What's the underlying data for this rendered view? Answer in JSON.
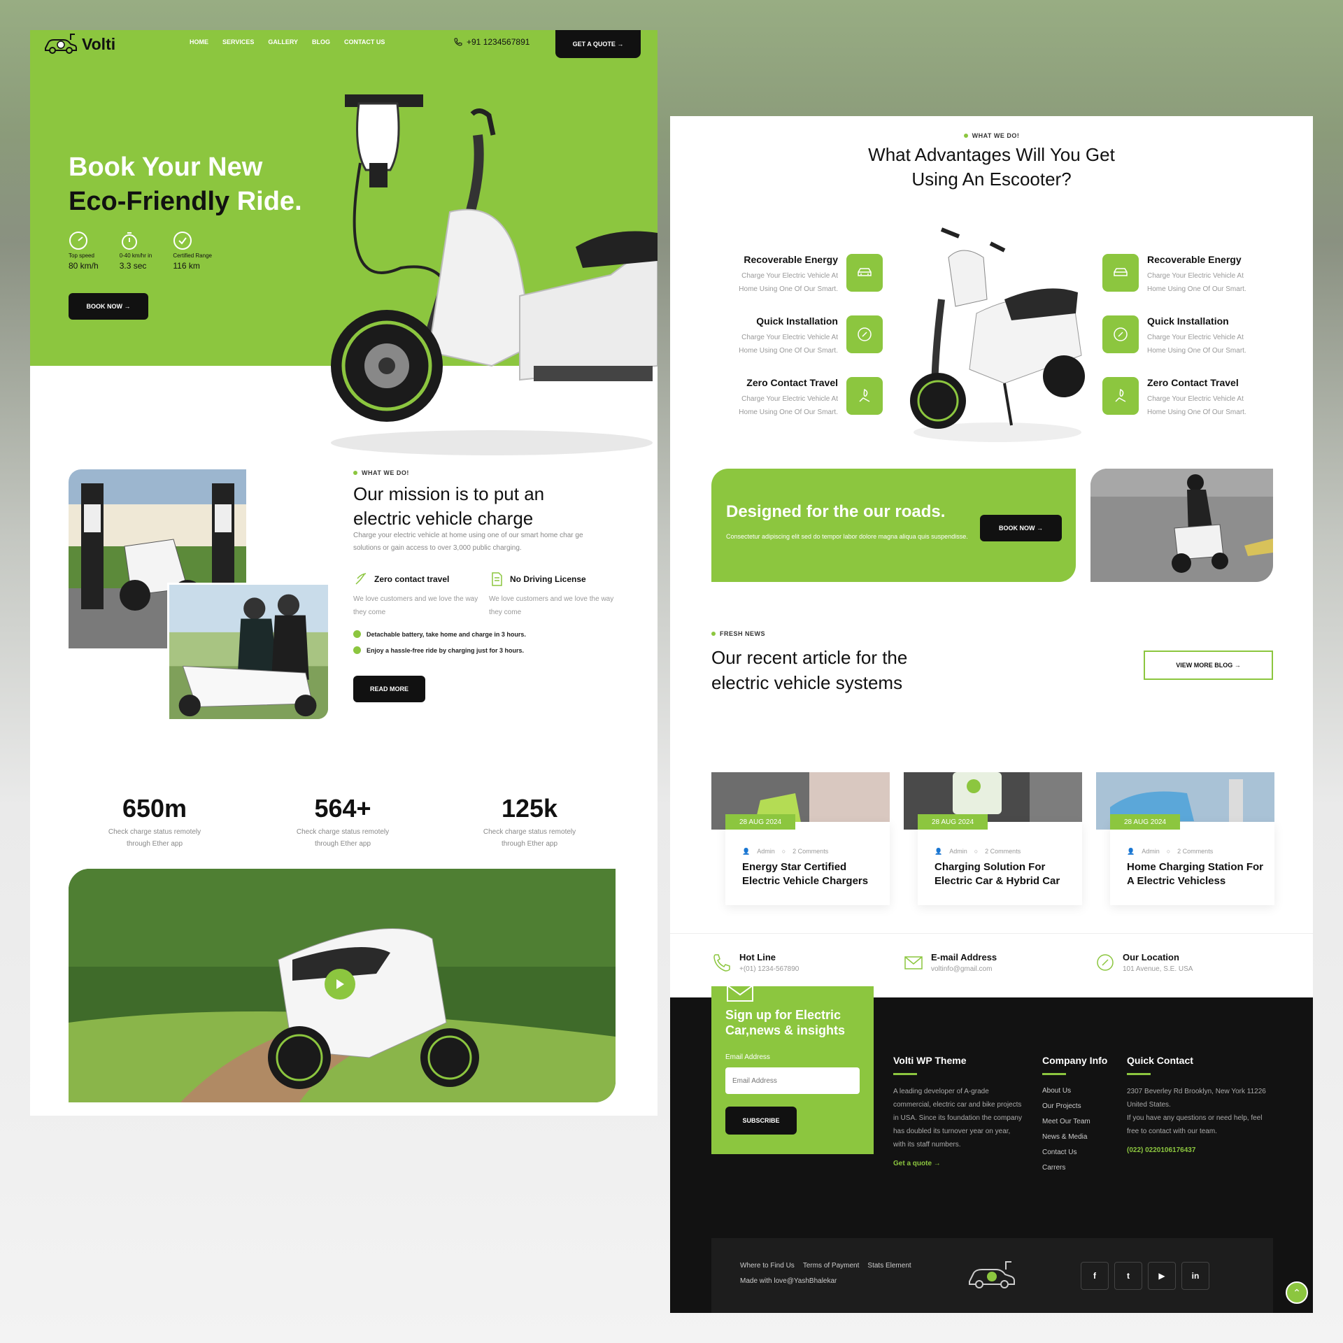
{
  "nav": {
    "brand": "Volti",
    "items": [
      "HOME",
      "SERVICES",
      "GALLERY",
      "BLOG",
      "CONTACT US"
    ],
    "phone": "+91 1234567891",
    "quote": "GET A QUOTE →"
  },
  "hero": {
    "title_a": "Book Your New",
    "title_b": "Eco-Friendly ",
    "title_c": "Ride.",
    "stats": [
      {
        "label": "Top speed",
        "value": "80 km/h"
      },
      {
        "label": "0-40 km/hr in",
        "value": "3.3 sec"
      },
      {
        "label": "Certified Range",
        "value": "116 km"
      }
    ],
    "cta": "BOOK NOW →"
  },
  "mission": {
    "eyebrow": "WHAT WE DO!",
    "title": "Our mission is to put an electric vehicle charge",
    "desc": "Charge your electric vehicle at home using one of our smart home char ge solutions or gain access to over 3,000 public charging.",
    "f1": {
      "title": "Zero contact travel",
      "text": "We love customers and we love the way they come"
    },
    "f2": {
      "title": "No Driving License",
      "text": "We love customers and we love the way they come"
    },
    "checks": [
      "Detachable battery, take home and charge in 3 hours.",
      "Enjoy a hassle-free ride by charging just for 3 hours."
    ],
    "cta": "READ MORE"
  },
  "stats": [
    {
      "n": "650m",
      "d": "Check charge status remotely through Ether app"
    },
    {
      "n": "564+",
      "d": "Check charge status remotely through Ether app"
    },
    {
      "n": "125k",
      "d": "Check charge status remotely through Ether app"
    }
  ],
  "adv": {
    "eyebrow": "WHAT WE DO!",
    "title": "What Advantages Will You Get Using An Escooter?",
    "items": [
      {
        "h": "Recoverable Energy",
        "p": "Charge Your Electric Vehicle At Home Using One Of Our Smart."
      },
      {
        "h": "Quick Installation",
        "p": "Charge Your Electric Vehicle At Home Using One Of Our Smart."
      },
      {
        "h": "Zero Contact Travel",
        "p": "Charge Your Electric Vehicle At Home Using One Of Our Smart."
      }
    ]
  },
  "banner": {
    "title": "Designed for the our roads.",
    "desc": "Consectetur adipiscing elit sed do tempor labor dolore magna aliqua quis suspendisse.",
    "cta": "BOOK NOW →"
  },
  "news": {
    "eyebrow": "FRESH NEWS",
    "title": "Our recent article for the electric vehicle systems",
    "cta": "VIEW MORE BLOG →",
    "cards": [
      {
        "date": "28 AUG 2024",
        "author": "Admin",
        "comments": "2 Comments",
        "title": "Energy Star Certified Electric Vehicle Chargers"
      },
      {
        "date": "28 AUG 2024",
        "author": "Admin",
        "comments": "2 Comments",
        "title": "Charging Solution For Electric Car & Hybrid Car"
      },
      {
        "date": "28 AUG 2024",
        "author": "Admin",
        "comments": "2 Comments",
        "title": "Home Charging Station For A Electric Vehicless"
      }
    ]
  },
  "contacts": [
    {
      "h": "Hot Line",
      "v": "+(01) 1234-567890"
    },
    {
      "h": "E-mail Address",
      "v": "voltinfo@gmail.com"
    },
    {
      "h": "Our Location",
      "v": "101 Avenue, S.E. USA"
    }
  ],
  "signup": {
    "title": "Sign up for Electric Car,news & insights",
    "label": "Email Address",
    "placeholder": "Email Address",
    "cta": "SUBSCRIBE"
  },
  "footer": {
    "c1": {
      "h": "Volti WP Theme",
      "p": "A leading developer of A-grade commercial, electric car and bike projects in USA. Since its foundation the company has doubled its turnover year on year, with its staff numbers.",
      "link": "Get a quote →"
    },
    "c2": {
      "h": "Company Info",
      "items": [
        "About Us",
        "Our Projects",
        "Meet Our Team",
        "News & Media",
        "Contact Us",
        "Carrers"
      ]
    },
    "c3": {
      "h": "Quick Contact",
      "addr": "2307 Beverley Rd Brooklyn, New York 11226 United States.",
      "help": "If you have any questions or need help, feel free to contact with our team.",
      "phone": "(022) 0220106176437"
    },
    "links": [
      "Where to Find Us",
      "Terms of Payment",
      "Stats Element"
    ],
    "made": "Made with love@YashBhalekar",
    "social": [
      "f",
      "t",
      "▶",
      "in"
    ]
  },
  "colors": {
    "accent": "#8cc63f",
    "dark": "#121212"
  }
}
